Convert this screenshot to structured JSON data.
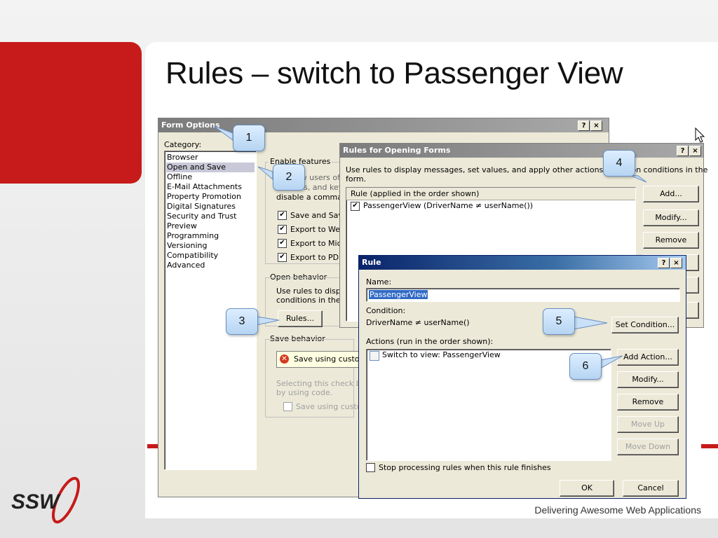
{
  "slide": {
    "title": "Rules – switch to Passenger View",
    "footer": "Delivering Awesome Web Applications",
    "logo_text": "SSW"
  },
  "colors": {
    "accent_red": "#c71a1a",
    "active_title": "#0a246a"
  },
  "form_options": {
    "title": "Form Options",
    "category_label": "Category:",
    "categories": [
      "Browser",
      "Open and Save",
      "Offline",
      "E-Mail Attachments",
      "Property Promotion",
      "Digital Signatures",
      "Security and Trust",
      "Preview",
      "Programming",
      "Versioning",
      "Compatibility",
      "Advanced"
    ],
    "selected_category": "Open and Save",
    "enable_features_label": "Enable features",
    "enable_text_1": "To allow users of",
    "enable_text_2": "toolbars, and key",
    "enable_text_3": "disable a comman",
    "feature_checks": [
      "Save and Sav",
      "Export to Wel",
      "Export to Micr",
      "Export to PDF"
    ],
    "open_behavior_label": "Open behavior",
    "open_text_1": "Use rules to displ",
    "open_text_2": "conditions in the f",
    "rules_button": "Rules...",
    "save_behavior_label": "Save behavior",
    "save_using_custom": "Save using custom",
    "selecting_text_1": "Selecting this check bo:",
    "selecting_text_2": "by using code.",
    "save_using_custom_check": "Save using custom",
    "help": "?",
    "close": "×"
  },
  "rules_for_opening": {
    "title": "Rules for Opening Forms",
    "intro_1": "Use rules to display messages, set values, and apply other actions based on conditions in the",
    "intro_2": "form.",
    "list_header": "Rule (applied in the order shown)",
    "rules": [
      "PassengerView (DriverName ≠ userName())"
    ],
    "buttons": {
      "add": "Add...",
      "modify": "Modify...",
      "remove": "Remove"
    },
    "help": "?",
    "close": "×"
  },
  "rule_dialog": {
    "title": "Rule",
    "name_label": "Name:",
    "name_value": "PassengerView",
    "condition_label": "Condition:",
    "condition_value": "DriverName ≠ userName()",
    "set_condition": "Set Condition...",
    "actions_label": "Actions (run in the order shown):",
    "actions": [
      "Switch to view: PassengerView"
    ],
    "buttons": {
      "add_action": "Add Action...",
      "modify": "Modify...",
      "remove": "Remove",
      "move_up": "Move Up",
      "move_down": "Move Down"
    },
    "stop_processing": "Stop processing rules when this rule finishes",
    "ok": "OK",
    "cancel": "Cancel",
    "help": "?",
    "close": "×"
  },
  "callouts": [
    "1",
    "2",
    "3",
    "4",
    "5",
    "6"
  ]
}
